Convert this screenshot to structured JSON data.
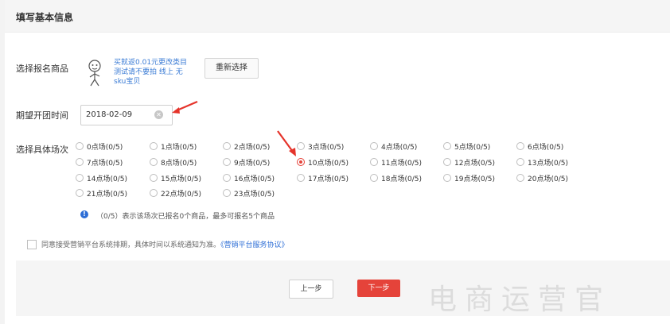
{
  "header": {
    "title": "填写基本信息"
  },
  "labels": {
    "product": "选择报名商品",
    "date": "期望开团时间",
    "session": "选择具体场次"
  },
  "product": {
    "name": "买就返0.01元更改类目 测试请不要拍 线上 无sku宝贝",
    "reselect_label": "重新选择"
  },
  "date_input": {
    "value": "2018-02-09",
    "clear_symbol": "✕"
  },
  "sessions": [
    {
      "label": "0点场(0/5)",
      "checked": false
    },
    {
      "label": "1点场(0/5)",
      "checked": false
    },
    {
      "label": "2点场(0/5)",
      "checked": false
    },
    {
      "label": "3点场(0/5)",
      "checked": false
    },
    {
      "label": "4点场(0/5)",
      "checked": false
    },
    {
      "label": "5点场(0/5)",
      "checked": false
    },
    {
      "label": "6点场(0/5)",
      "checked": false
    },
    {
      "label": "7点场(0/5)",
      "checked": false
    },
    {
      "label": "8点场(0/5)",
      "checked": false
    },
    {
      "label": "9点场(0/5)",
      "checked": false
    },
    {
      "label": "10点场(0/5)",
      "checked": true
    },
    {
      "label": "11点场(0/5)",
      "checked": false
    },
    {
      "label": "12点场(0/5)",
      "checked": false
    },
    {
      "label": "13点场(0/5)",
      "checked": false
    },
    {
      "label": "14点场(0/5)",
      "checked": false
    },
    {
      "label": "15点场(0/5)",
      "checked": false
    },
    {
      "label": "16点场(0/5)",
      "checked": false
    },
    {
      "label": "17点场(0/5)",
      "checked": false
    },
    {
      "label": "18点场(0/5)",
      "checked": false
    },
    {
      "label": "19点场(0/5)",
      "checked": false
    },
    {
      "label": "20点场(0/5)",
      "checked": false
    },
    {
      "label": "21点场(0/5)",
      "checked": false
    },
    {
      "label": "22点场(0/5)",
      "checked": false
    },
    {
      "label": "23点场(0/5)",
      "checked": false
    }
  ],
  "info": {
    "icon_symbol": "!",
    "text": "（0/5）表示该场次已报名0个商品，最多可报名5个商品"
  },
  "agreement": {
    "text": "同意接受营销平台系统排期，具体时间以系统通知为准。",
    "link": "《营销平台服务协议》"
  },
  "footer": {
    "prev_label": "上一步",
    "next_label": "下一步"
  },
  "watermark": "电商运营官",
  "colors": {
    "accent": "#e5433a",
    "link": "#2d6ed6",
    "header_bg": "#f5f5f5"
  },
  "icons": {
    "product_image": "product-thumbnail-icon",
    "info": "info-icon",
    "clear": "clear-icon"
  }
}
